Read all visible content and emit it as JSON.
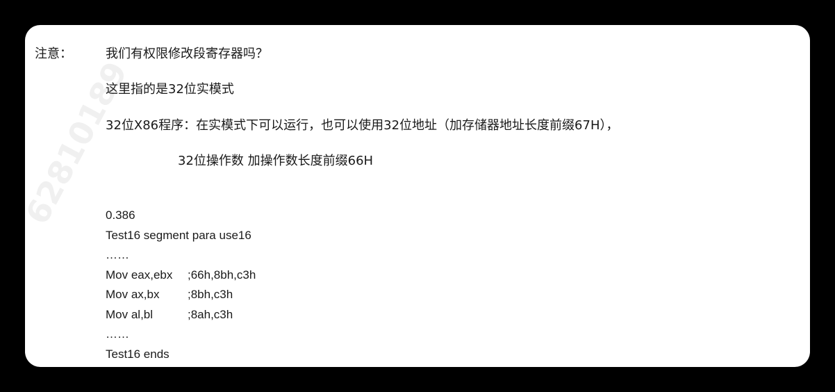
{
  "note": {
    "label": "注意：",
    "question": "我们有权限修改段寄存器吗？",
    "line1": "这里指的是32位实模式",
    "line2": "32位X86程序：在实模式下可以运行，也可以使用32位地址（加存储器地址长度前缀67H），",
    "line3": "32位操作数 加操作数长度前缀66H"
  },
  "code": [
    {
      "text": "0.386",
      "comment": ""
    },
    {
      "text": "Test16 segment para use16",
      "comment": ""
    },
    {
      "text": "……",
      "comment": ""
    },
    {
      "text": "Mov eax,ebx",
      "comment": ";66h,8bh,c3h"
    },
    {
      "text": "Mov ax,bx",
      "comment": ";8bh,c3h"
    },
    {
      "text": "Mov al,bl",
      "comment": ";8ah,c3h"
    },
    {
      "text": "……",
      "comment": ""
    },
    {
      "text": "Test16 ends",
      "comment": ""
    }
  ],
  "watermark": "62810189"
}
